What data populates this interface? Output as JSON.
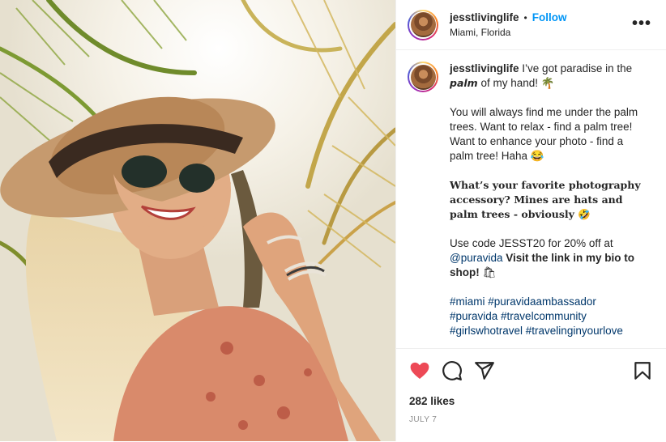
{
  "post": {
    "username": "jesstlivinglife",
    "follow_label": "Follow",
    "separator": "•",
    "location": "Miami, Florida",
    "more_icon": "more-horizontal-icon"
  },
  "caption": {
    "username": "jesstlivinglife",
    "line1_pre": "I’ve got paradise in the",
    "line1_bold": "palm",
    "line1_post": "of my hand! 🌴",
    "para2": "You will always find me under the palm trees. Want to relax - find a palm tree! Want to enhance your photo - find a palm tree! Haha 😂",
    "para3": "What’s your favorite photography accessory? Mines are hats and palm trees - obviously 🤣",
    "para4_pre": "Use code JESST20 for 20% off at",
    "para4_mention": "@puravida",
    "para4_bold": "Visit the link in my bio to shop!",
    "para4_emoji": "🛍",
    "hashtags_line1": "#miami #puravidaambassador",
    "hashtags_line2": "#puravida #travelcommunity",
    "hashtags_line3": "#girlswhotravel #travelinginyourlove"
  },
  "actions": {
    "like_icon": "heart-filled-icon",
    "comment_icon": "comment-icon",
    "share_icon": "send-icon",
    "save_icon": "bookmark-icon",
    "likes": "282 likes",
    "date": "JULY 7"
  },
  "colors": {
    "follow": "#0095f6",
    "like": "#ed4956",
    "hashtag": "#00376b"
  }
}
